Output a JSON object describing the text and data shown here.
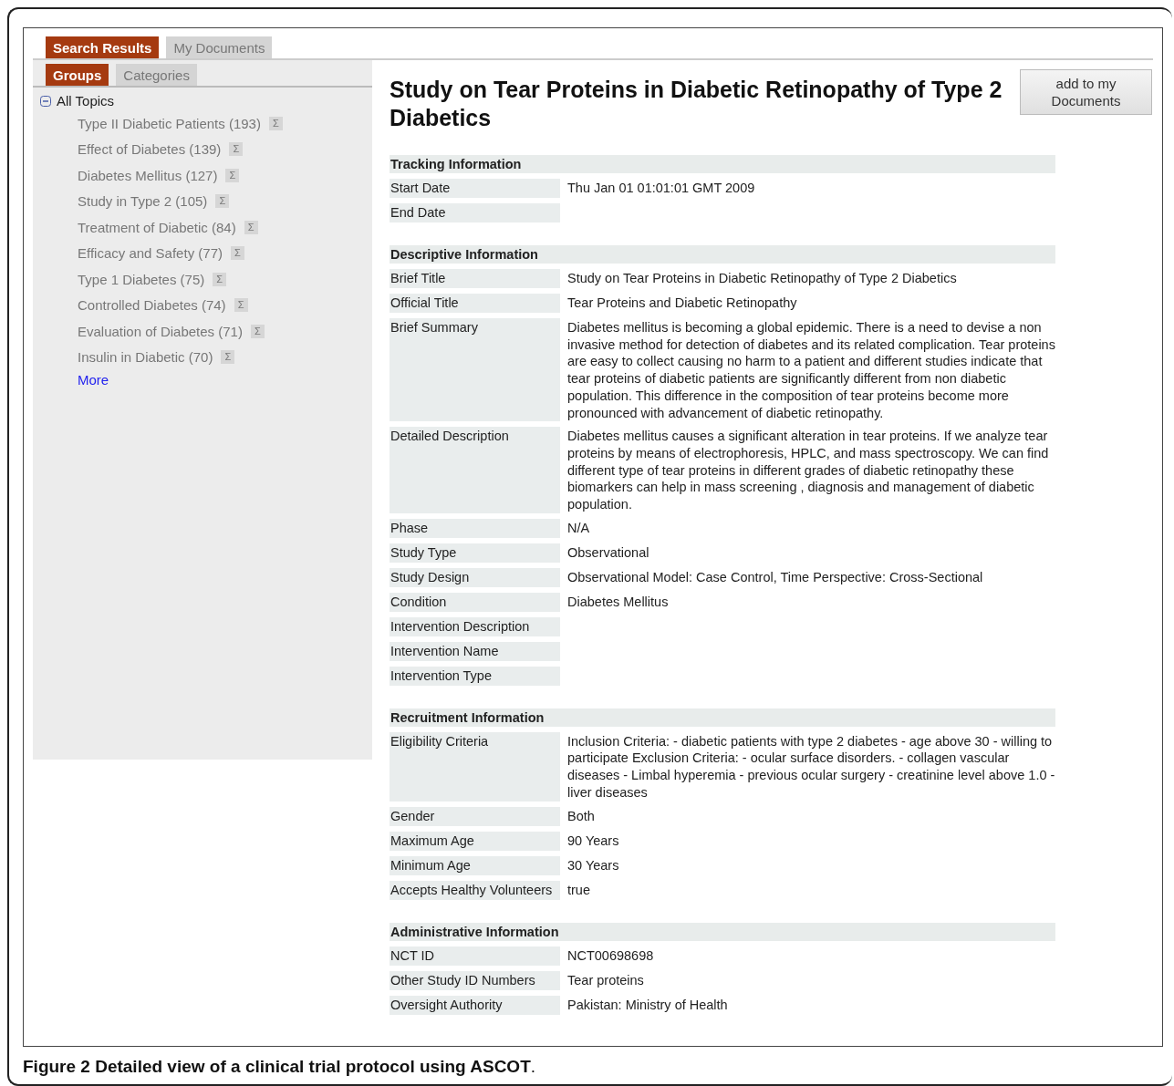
{
  "top_tabs": [
    {
      "label": "Search Results",
      "selected": true
    },
    {
      "label": "My Documents",
      "selected": false
    }
  ],
  "side_tabs": [
    {
      "label": "Groups",
      "selected": true
    },
    {
      "label": "Categories",
      "selected": false
    }
  ],
  "tree": {
    "label": "All Topics",
    "expanded": true,
    "children": [
      {
        "label": "Type II Diabetic Patients (193)",
        "action": "Σ"
      },
      {
        "label": "Effect of Diabetes (139)",
        "action": "Σ"
      },
      {
        "label": "Diabetes Mellitus (127)",
        "action": "Σ"
      },
      {
        "label": "Study in Type 2 (105)",
        "action": "Σ"
      },
      {
        "label": "Treatment of Diabetic (84)",
        "action": "Σ"
      },
      {
        "label": "Efficacy and Safety (77)",
        "action": "Σ"
      },
      {
        "label": "Type 1 Diabetes (75)",
        "action": "Σ"
      },
      {
        "label": "Controlled Diabetes (74)",
        "action": "Σ"
      },
      {
        "label": "Evaluation of Diabetes (71)",
        "action": "Σ"
      },
      {
        "label": "Insulin in Diabetic (70)",
        "action": "Σ"
      }
    ],
    "more": "More"
  },
  "study": {
    "title": "Study on Tear Proteins in Diabetic Retinopathy of Type 2 Diabetics",
    "button": "add to my Documents",
    "sections": [
      {
        "title": "Tracking Information",
        "rows": [
          {
            "label": "Start Date",
            "value": "Thu Jan 01 01:01:01 GMT 2009"
          },
          {
            "label": "End Date"
          }
        ]
      },
      {
        "title": "Descriptive Information",
        "rows": [
          {
            "label": "Brief Title",
            "value": "Study on Tear Proteins in Diabetic Retinopathy of Type 2 Diabetics"
          },
          {
            "label": "Official Title",
            "value": "Tear Proteins and Diabetic Retinopathy"
          },
          {
            "label": "Brief Summary",
            "value": "Diabetes mellitus is becoming a global epidemic. There is a need to devise a non invasive method for detection of diabetes and its related complication. Tear proteins are easy to collect causing no harm to a patient and different studies indicate that tear proteins of diabetic patients are significantly different from non diabetic population. This difference in the composition of tear proteins become more pronounced with advancement of diabetic retinopathy."
          },
          {
            "label": "Detailed Description",
            "value": "Diabetes mellitus causes a significant alteration in tear proteins. If we analyze tear proteins by means of electrophoresis, HPLC, and mass spectroscopy. We can find different type of tear proteins in different grades of diabetic retinopathy these biomarkers can help in mass screening , diagnosis and management of diabetic population."
          },
          {
            "label": "Phase",
            "value": "N/A"
          },
          {
            "label": "Study Type",
            "value": "Observational"
          },
          {
            "label": "Study Design",
            "value": "Observational Model: Case Control, Time Perspective: Cross-Sectional"
          },
          {
            "label": "Condition",
            "value": "Diabetes Mellitus"
          },
          {
            "label": "Intervention Description"
          },
          {
            "label": "Intervention Name"
          },
          {
            "label": "Intervention Type"
          }
        ]
      },
      {
        "title": "Recruitment Information",
        "rows": [
          {
            "label": "Eligibility Criteria",
            "value": "Inclusion Criteria: - diabetic patients with type 2 diabetes - age above 30 - willing to participate Exclusion Criteria: - ocular surface disorders. - collagen vascular diseases - Limbal hyperemia - previous ocular surgery - creatinine level above 1.0 - liver diseases"
          },
          {
            "label": "Gender",
            "value": "Both"
          },
          {
            "label": "Maximum Age",
            "value": "90 Years"
          },
          {
            "label": "Minimum Age",
            "value": "30 Years"
          },
          {
            "label": "Accepts Healthy Volunteers",
            "value": "true"
          }
        ]
      },
      {
        "title": "Administrative Information",
        "rows": [
          {
            "label": "NCT ID",
            "value": "NCT00698698"
          },
          {
            "label": "Other Study ID Numbers",
            "value": "Tear proteins"
          },
          {
            "label": "Oversight Authority",
            "value": "Pakistan: Ministry of Health"
          }
        ]
      }
    ]
  },
  "caption": "**Figure 2 Detailed view of a clinical trial protocol using ASCOT**."
}
